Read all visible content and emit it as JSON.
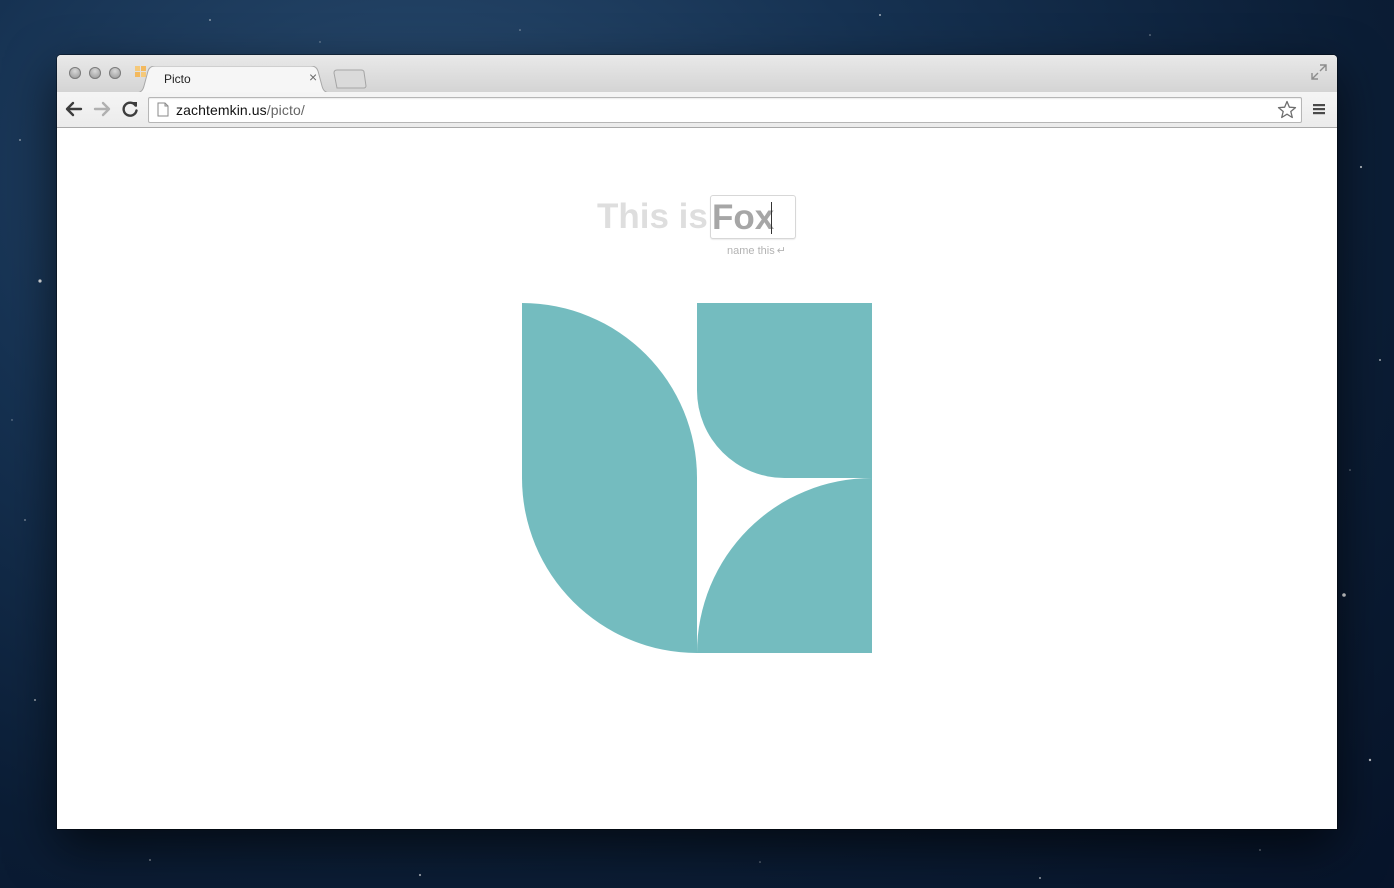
{
  "browser": {
    "tab_title": "Picto",
    "tab_close": "×",
    "url_host": "zachtemkin.us",
    "url_path": "/picto/",
    "icons": {
      "back": "arrow-left-icon",
      "forward": "arrow-right-icon",
      "reload": "reload-icon",
      "bookmark": "star-icon",
      "menu": "hamburger-menu-icon",
      "fullscreen": "fullscreen-icon",
      "favicon": "picto-favicon-icon",
      "page": "document-page-icon"
    }
  },
  "page": {
    "heading_prefix": "This is",
    "name_value": "Fox",
    "hint": "name this",
    "hint_icon": "↵",
    "picto_color": "#74bcbf"
  }
}
